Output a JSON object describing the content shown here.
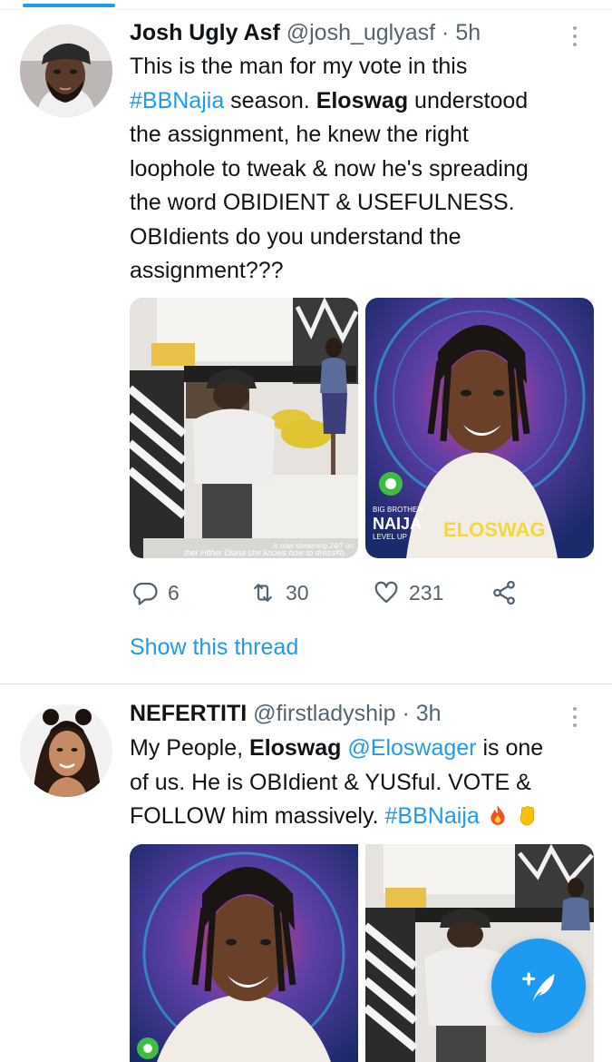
{
  "tweets": [
    {
      "name": "Josh Ugly Asf",
      "handle": "@josh_uglyasf",
      "separator": "·",
      "time": "5h",
      "text": {
        "l1": "This is the man for my vote in this",
        "l2_tag": "#BBNajia",
        "l2_mid": " season. ",
        "l2_bold": "Eloswag",
        "l2_end": " understood",
        "l3": "the assignment, he knew the right",
        "l4": "loophole to tweak & now he's spreading",
        "l5": "the word OBIDIENT & USEFULNESS.",
        "l6": "OBIdients do you understand the",
        "l7": "assignment???"
      },
      "media": {
        "left_caption": "ther Hither  Diana she knows how to dress#b",
        "left_caption2": "is now streaming 24/7 on",
        "right_brand_top": "BIG BROTHER",
        "right_brand_main": "NAIJA",
        "right_brand_sub": "LEVEL UP",
        "right_name": "ELOSWAG"
      },
      "stats": {
        "replies": "6",
        "retweets": "30",
        "likes": "231"
      },
      "show_thread": "Show this thread"
    },
    {
      "name": "NEFERTITI",
      "handle": "@firstladyship",
      "separator": "·",
      "time": "3h",
      "text": {
        "l1_start": "My People, ",
        "l1_bold": "Eloswag",
        "l1_space": " ",
        "l1_mention": "@Eloswager",
        "l1_end": " is one",
        "l2": "of us. He is OBIdient & YUSful. VOTE &",
        "l3_start": "FOLLOW him massively. ",
        "l3_tag": "#BBNaija"
      }
    }
  ],
  "icons": {
    "reply": "reply-icon",
    "retweet": "retweet-icon",
    "like": "heart-icon",
    "share": "share-icon",
    "compose": "compose-tweet-icon"
  },
  "colors": {
    "accent": "#1d9bf0",
    "muted": "#536471",
    "text": "#0f1419"
  }
}
